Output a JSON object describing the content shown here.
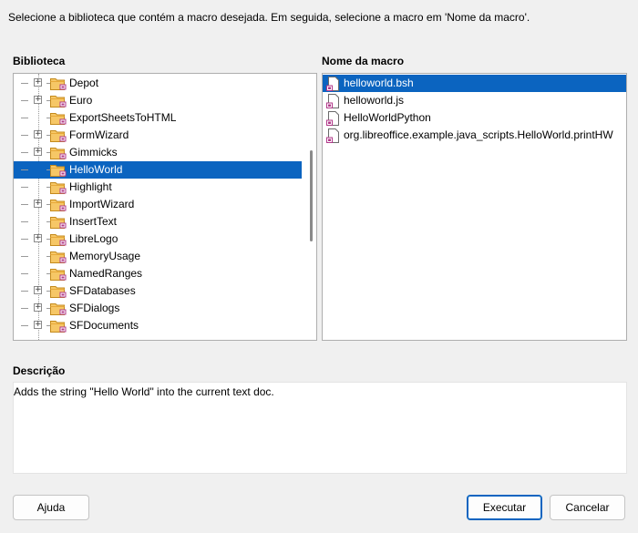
{
  "instruction": "Selecione a biblioteca que contém a macro desejada. Em seguida, selecione a macro em 'Nome da macro'.",
  "library_label": "Biblioteca",
  "macro_label": "Nome da macro",
  "description_label": "Descrição",
  "description_text": "Adds the string \"Hello World\" into the current text doc.",
  "libraries": [
    {
      "name": "Depot",
      "expandable": true
    },
    {
      "name": "Euro",
      "expandable": true
    },
    {
      "name": "ExportSheetsToHTML",
      "expandable": false
    },
    {
      "name": "FormWizard",
      "expandable": true
    },
    {
      "name": "Gimmicks",
      "expandable": true
    },
    {
      "name": "HelloWorld",
      "expandable": false,
      "selected": true
    },
    {
      "name": "Highlight",
      "expandable": false
    },
    {
      "name": "ImportWizard",
      "expandable": true
    },
    {
      "name": "InsertText",
      "expandable": false
    },
    {
      "name": "LibreLogo",
      "expandable": true
    },
    {
      "name": "MemoryUsage",
      "expandable": false
    },
    {
      "name": "NamedRanges",
      "expandable": false
    },
    {
      "name": "SFDatabases",
      "expandable": true
    },
    {
      "name": "SFDialogs",
      "expandable": true
    },
    {
      "name": "SFDocuments",
      "expandable": true
    }
  ],
  "macros": [
    {
      "name": "helloworld.bsh",
      "selected": true
    },
    {
      "name": "helloworld.js"
    },
    {
      "name": "HelloWorldPython"
    },
    {
      "name": "org.libreoffice.example.java_scripts.HelloWorld.printHW"
    }
  ],
  "buttons": {
    "help": "Ajuda",
    "run": "Executar",
    "cancel": "Cancelar"
  },
  "colors": {
    "selection": "#0b64c0",
    "folder_fill": "#f6c766",
    "macro_accent": "#b1388a"
  },
  "icons": {
    "folder": "folder-macro-icon",
    "document": "macro-document-icon",
    "expand": "plus-expander-icon"
  }
}
